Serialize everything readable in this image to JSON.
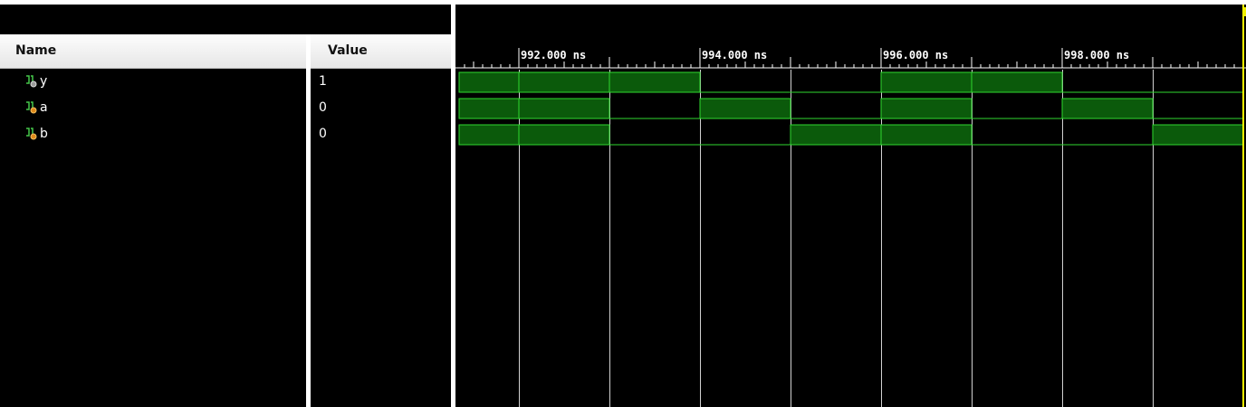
{
  "columns": {
    "name": "Name",
    "value": "Value"
  },
  "signals": [
    {
      "name": "y",
      "value": "1",
      "icon": "output-signal-icon"
    },
    {
      "name": "a",
      "value": "0",
      "icon": "input-signal-icon"
    },
    {
      "name": "b",
      "value": "0",
      "icon": "input-signal-icon"
    }
  ],
  "timeline": {
    "labels": [
      "992.000 ns",
      "994.000 ns",
      "996.000 ns",
      "998.000 ns"
    ],
    "start_ns": 991.35,
    "end_ns": 1000.0,
    "cursor_ns": 1000.0
  },
  "waveforms": {
    "step_ns": 1.0,
    "y": [
      1,
      1,
      1,
      0,
      0,
      1,
      1,
      0,
      0,
      1
    ],
    "a": [
      1,
      1,
      0,
      1,
      0,
      1,
      0,
      1,
      0,
      1
    ],
    "b": [
      1,
      1,
      0,
      0,
      1,
      1,
      0,
      0,
      1,
      1
    ],
    "transitions_ns": [
      992,
      993,
      994,
      995,
      996,
      997,
      998,
      999
    ]
  },
  "colors": {
    "wave_fill": "#0b5a0b",
    "wave_line": "#2fd82f",
    "grid": "#e8e8e8",
    "cursor": "#f0f000",
    "background": "#000000"
  }
}
